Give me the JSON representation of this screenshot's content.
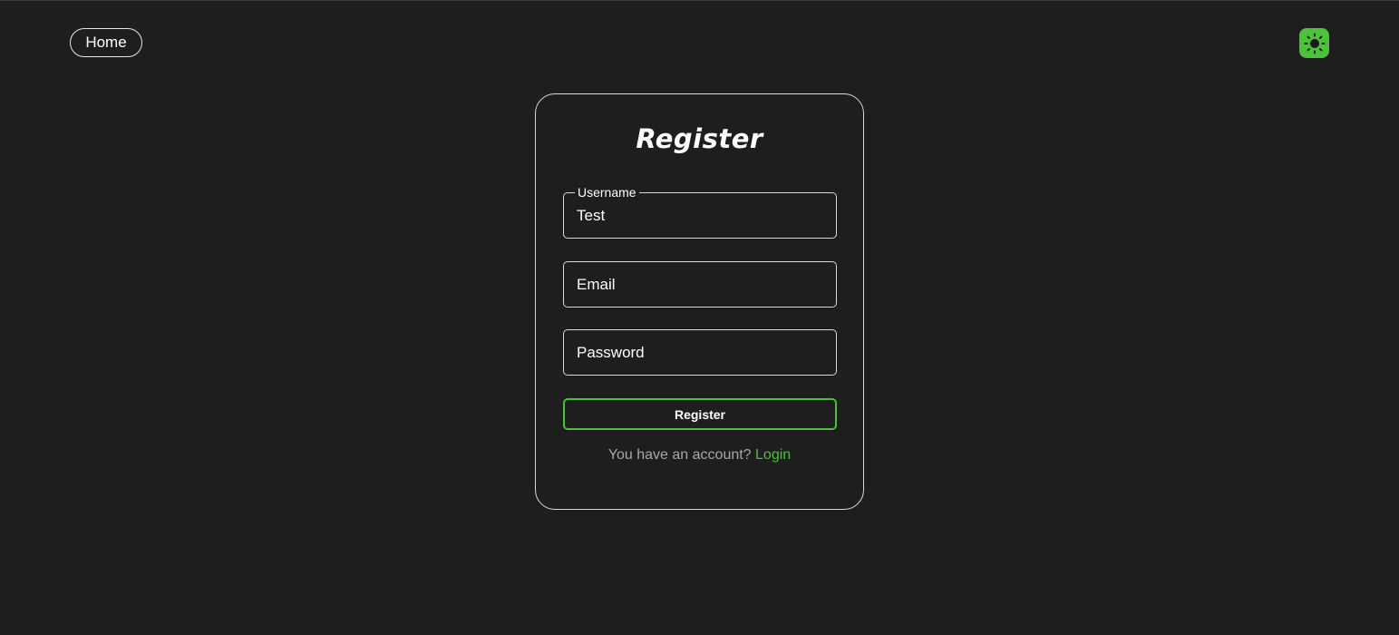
{
  "nav": {
    "home_label": "Home",
    "theme_icon": "sun-icon"
  },
  "form": {
    "title": "Register",
    "username": {
      "legend": "Username",
      "value": "Test"
    },
    "email": {
      "placeholder": "Email"
    },
    "password": {
      "placeholder": "Password"
    },
    "submit_label": "Register",
    "account_prompt": "You have an account?",
    "login_label": "Login"
  },
  "colors": {
    "background": "#1e1e1e",
    "accent": "#4cc13a",
    "border": "#d9d9d9",
    "muted_text": "#a8a8a8"
  }
}
